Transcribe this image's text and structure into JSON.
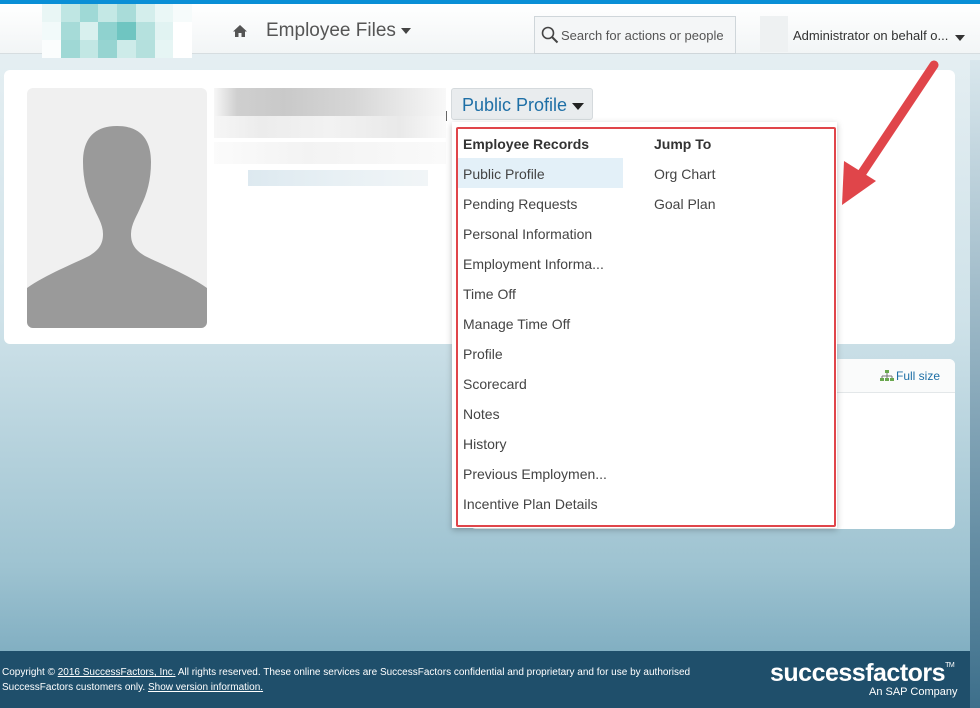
{
  "header": {
    "module_title": "Employee Files",
    "search_placeholder": "Search for actions or people",
    "user_label": "Administrator on behalf o..."
  },
  "profile": {
    "view_button_label": "Public Profile"
  },
  "dropdown": {
    "left_heading": "Employee Records",
    "left_items": [
      "Public Profile",
      "Pending Requests",
      "Personal Information",
      "Employment Informa...",
      "Time Off",
      "Manage Time Off",
      "Profile",
      "Scorecard",
      "Notes",
      "History",
      "Previous Employmen...",
      "Incentive Plan Details"
    ],
    "right_heading": "Jump To",
    "right_items": [
      "Org Chart",
      "Goal Plan"
    ]
  },
  "card": {
    "full_size_label": "Full size"
  },
  "footer": {
    "copyright_prefix": "Copyright ©",
    "copyright_link": "2016 SuccessFactors, Inc.",
    "copyright_text": "All rights reserved. These online services are SuccessFactors confidential and proprietary and for use by authorised SuccessFactors customers only.",
    "version_link": "Show version information.",
    "brand": "successfactors",
    "brand_sub": "An SAP Company"
  },
  "colors": {
    "accent": "#0a8fd6",
    "link": "#1e6fa6",
    "annotation": "#e0454a",
    "footer_bg": "#1f4f6b"
  },
  "icons": [
    "home-icon",
    "search-icon",
    "caret-down-icon",
    "avatar-placeholder-icon",
    "full-size-icon",
    "annotation-arrow"
  ]
}
